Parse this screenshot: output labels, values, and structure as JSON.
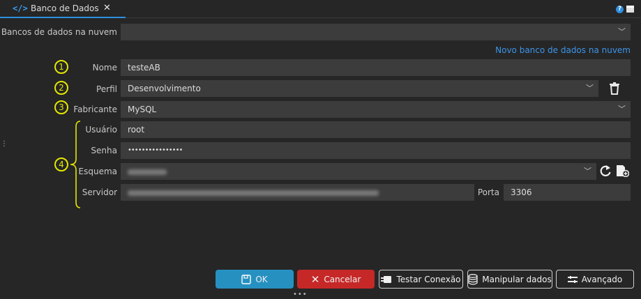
{
  "tab": {
    "title": "Banco de Dados",
    "icon": "code-icon"
  },
  "window_controls": {
    "help": "?"
  },
  "cloud": {
    "label": "Bancos de dados na nuvem",
    "value": "",
    "new_link": "Novo banco de dados na nuvem"
  },
  "steps": [
    "1",
    "2",
    "3",
    "4"
  ],
  "form": {
    "nome": {
      "label": "Nome",
      "value": "testeAB"
    },
    "perfil": {
      "label": "Perfil",
      "value": "Desenvolvimento"
    },
    "fabricante": {
      "label": "Fabricante",
      "value": "MySQL"
    },
    "usuario": {
      "label": "Usuário",
      "value": "root"
    },
    "senha": {
      "label": "Senha",
      "value": "••••••••••••••••"
    },
    "esquema": {
      "label": "Esquema",
      "value": ""
    },
    "servidor": {
      "label": "Servidor",
      "value": ""
    },
    "porta": {
      "label": "Porta",
      "value": "3306"
    }
  },
  "buttons": {
    "ok": "OK",
    "cancel": "Cancelar",
    "test": "Testar Conexão",
    "manipulate": "Manipular dados",
    "advanced": "Avançado"
  },
  "colors": {
    "accent": "#2f8fe0",
    "ok": "#2691c1",
    "cancel": "#c62828",
    "annotation": "#e3e800"
  }
}
